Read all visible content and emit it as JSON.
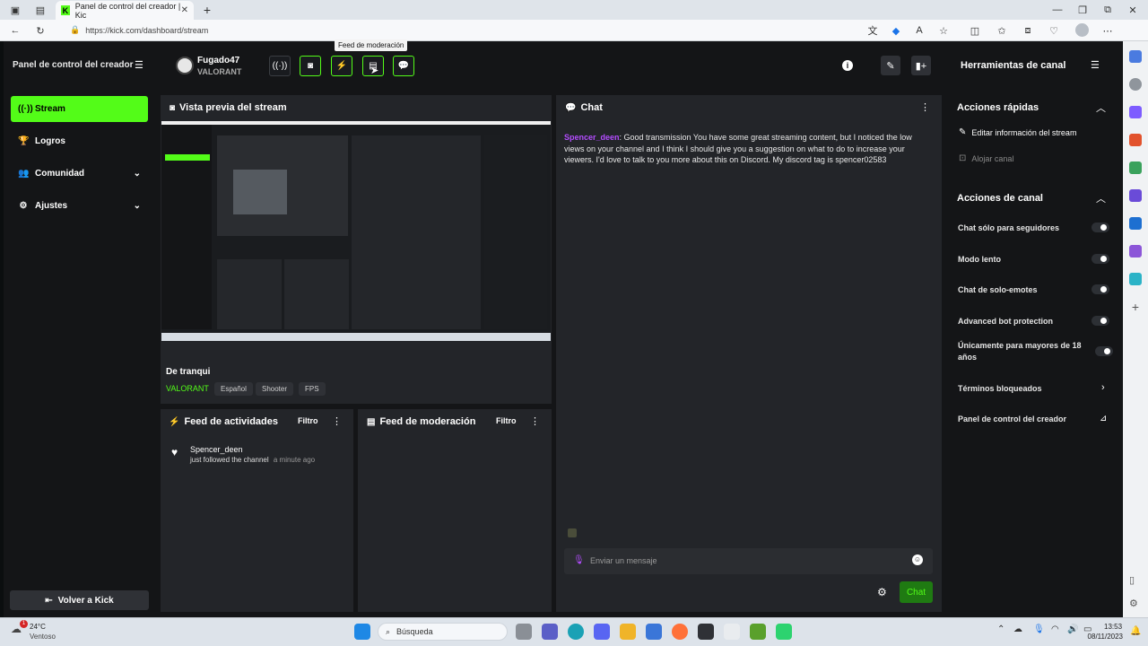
{
  "browser": {
    "tab_title": "Panel de control del creador | Kic",
    "url": "https://kick.com/dashboard/stream",
    "tooltip": "Feed de moderación"
  },
  "sidebar": {
    "title": "Panel de control del creador",
    "items": [
      {
        "label": "Stream",
        "icon": "broadcast-icon",
        "active": true
      },
      {
        "label": "Logros",
        "icon": "trophy-icon"
      },
      {
        "label": "Comunidad",
        "icon": "users-icon"
      },
      {
        "label": "Ajustes",
        "icon": "gear-icon"
      }
    ],
    "back_label": "Volver a Kick"
  },
  "channel": {
    "name": "Fugado47",
    "category": "VALORANT"
  },
  "preview": {
    "title": "Vista previa del stream"
  },
  "stream_info": {
    "title": "De tranqui",
    "category": "VALORANT",
    "tags": [
      "Español",
      "Shooter",
      "FPS"
    ]
  },
  "activity_feed": {
    "title": "Feed de actividades",
    "filter": "Filtro",
    "events": [
      {
        "user": "Spencer_deen",
        "action": "just followed the channel",
        "time": "a minute ago"
      }
    ]
  },
  "moderation_feed": {
    "title": "Feed de moderación",
    "filter": "Filtro"
  },
  "chat": {
    "title": "Chat",
    "messages": [
      {
        "user": "Spencer_deen",
        "text": ": Good transmission You have some great streaming content, but I noticed the low views on your channel and I think I should give you a suggestion on what to do to increase your viewers. I'd love to talk to you more about this on Discord. My discord tag is spencer02583"
      }
    ],
    "input_placeholder": "Enviar un mensaje",
    "send_label": "Chat"
  },
  "tools": {
    "title": "Herramientas de canal",
    "quick_actions_title": "Acciones rápidas",
    "quick_actions": [
      "Editar información del stream",
      "Alojar canal"
    ],
    "channel_actions_title": "Acciones de canal",
    "toggles": [
      "Chat sólo para seguidores",
      "Modo lento",
      "Chat de solo-emotes",
      "Advanced bot protection",
      "Únicamente para mayores de 18 años"
    ],
    "links": [
      "Términos bloqueados",
      "Panel de control del creador"
    ]
  },
  "taskbar": {
    "weather_temp": "24°C",
    "weather_desc": "Ventoso",
    "weather_badge": "1",
    "search_placeholder": "Búsqueda",
    "time": "13:53",
    "date": "08/11/2023"
  },
  "colors": {
    "accent": "#53fc18",
    "bg": "#141517",
    "panel": "#232529",
    "username": "#b44dff"
  }
}
